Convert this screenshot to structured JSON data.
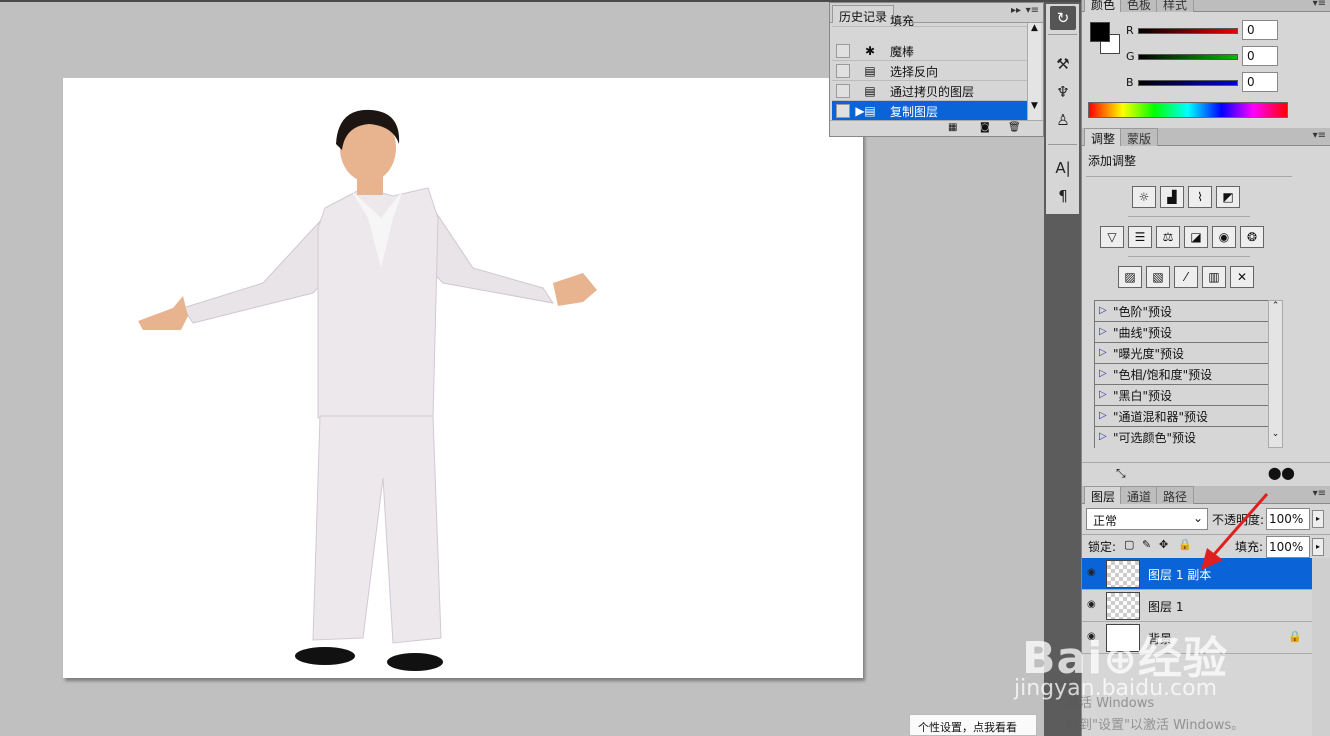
{
  "history_panel": {
    "tab": "历史记录",
    "top_item_partial": "填充",
    "items": [
      {
        "label": "魔棒",
        "icon": "magic-wand-icon"
      },
      {
        "label": "选择反向",
        "icon": "history-state-icon"
      },
      {
        "label": "通过拷贝的图层",
        "icon": "history-state-icon"
      },
      {
        "label": "复制图层",
        "icon": "history-state-icon",
        "selected": true
      }
    ]
  },
  "color_panel": {
    "tabs": [
      "颜色",
      "色板",
      "样式"
    ],
    "channels": [
      {
        "label": "R",
        "value": "0",
        "color": "#d00000"
      },
      {
        "label": "G",
        "value": "0",
        "color": "#00a000"
      },
      {
        "label": "B",
        "value": "0",
        "color": "#0000d0"
      }
    ],
    "foreground": "#000000",
    "background": "#ffffff"
  },
  "adjust_panel": {
    "tabs": [
      "调整",
      "蒙版"
    ],
    "title": "添加调整",
    "presets": [
      "\"色阶\"预设",
      "\"曲线\"预设",
      "\"曝光度\"预设",
      "\"色相/饱和度\"预设",
      "\"黑白\"预设",
      "\"通道混和器\"预设",
      "\"可选颜色\"预设"
    ]
  },
  "layers_panel": {
    "tabs": [
      "图层",
      "通道",
      "路径"
    ],
    "blend_mode": "正常",
    "opacity_label": "不透明度:",
    "opacity_value": "100%",
    "lock_label": "锁定:",
    "fill_label": "填充:",
    "fill_value": "100%",
    "layers": [
      {
        "name": "图层 1 副本",
        "selected": true
      },
      {
        "name": "图层 1",
        "selected": false
      },
      {
        "name": "背景",
        "selected": false,
        "locked": true
      }
    ]
  },
  "watermark": {
    "brand": "Bai",
    "brand_cn": "经验",
    "url": "jingyan.baidu.com",
    "activate_line1": "激活 Windows",
    "activate_line2": "转到\"设置\"以激活 Windows。"
  },
  "tooltip": "个性设置，点我看看",
  "colors": {
    "accent": "#0a64d8",
    "arrow": "#e02020"
  }
}
